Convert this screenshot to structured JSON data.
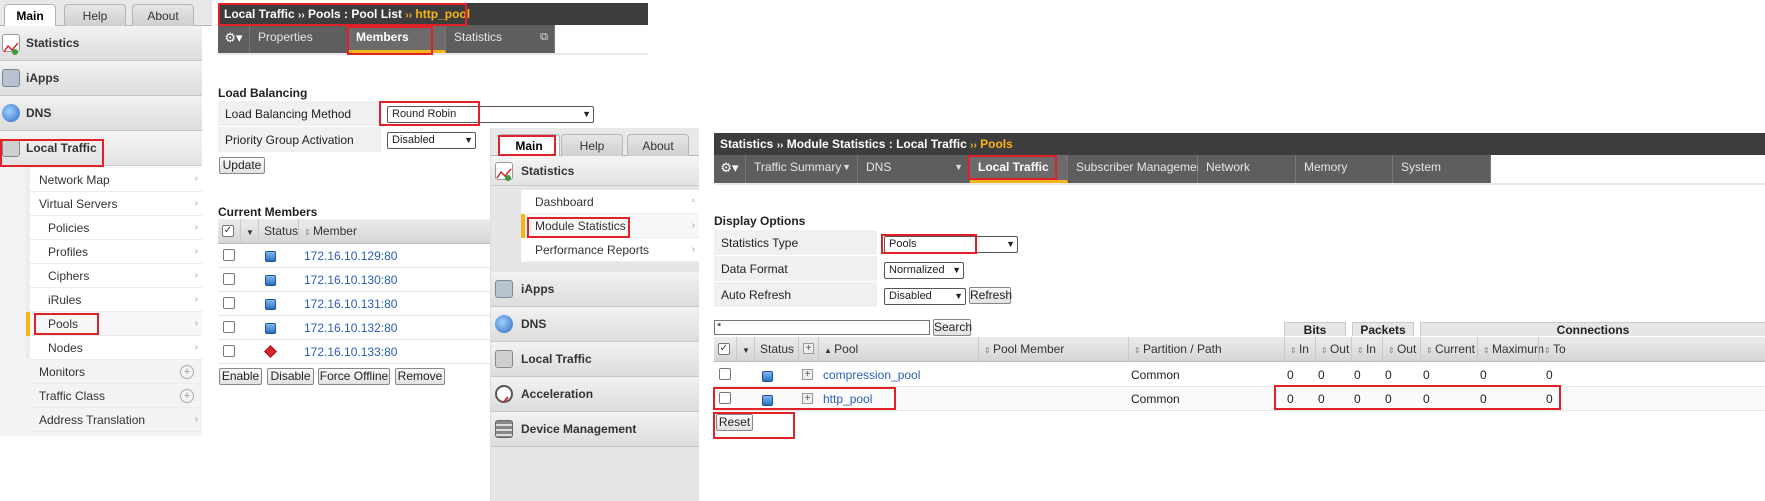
{
  "left_window": {
    "top_tabs": [
      "Main",
      "Help",
      "About"
    ],
    "title": {
      "part1": "Local Traffic",
      "sep1": "››",
      "part2": "Pools : Pool List",
      "sep2": "››",
      "part3": "http_pool"
    },
    "tabs": {
      "properties": "Properties",
      "members": "Members",
      "statistics": "Statistics"
    },
    "nav": {
      "statistics": "Statistics",
      "iapps": "iApps",
      "dns": "DNS",
      "local_traffic": "Local Traffic",
      "sub_items": [
        "Network Map",
        "Virtual Servers",
        "Policies",
        "Profiles",
        "Ciphers",
        "iRules",
        "Pools",
        "Nodes",
        "Monitors",
        "Traffic Class",
        "Address Translation"
      ]
    },
    "load_balancing": {
      "section_title": "Load Balancing",
      "method_label": "Load Balancing Method",
      "method_value": "Round Robin",
      "priority_label": "Priority Group Activation",
      "priority_value": "Disabled",
      "update_button": "Update"
    },
    "current_members": {
      "section_title": "Current Members",
      "col_status": "Status",
      "col_member": "Member",
      "rows": [
        "172.16.10.129:80",
        "172.16.10.130:80",
        "172.16.10.131:80",
        "172.16.10.132:80",
        "172.16.10.133:80"
      ],
      "buttons": [
        "Enable",
        "Disable",
        "Force Offline",
        "Remove"
      ]
    }
  },
  "right_window": {
    "top_tabs": [
      "Main",
      "Help",
      "About"
    ],
    "title": {
      "part1": "Statistics",
      "sep1": "››",
      "part2": "Module Statistics : Local Traffic",
      "sep2": "››",
      "part3": "Pools"
    },
    "tabs": [
      "Traffic Summary",
      "DNS",
      "Local Traffic",
      "Subscriber Management",
      "Network",
      "Memory",
      "System"
    ],
    "nav": {
      "statistics": "Statistics",
      "sub_items": [
        "Dashboard",
        "Module Statistics",
        "Performance Reports"
      ],
      "iapps": "iApps",
      "dns": "DNS",
      "local_traffic": "Local Traffic",
      "acceleration": "Acceleration",
      "device_management": "Device Management"
    },
    "display_options": {
      "section_title": "Display Options",
      "stats_type_label": "Statistics Type",
      "stats_type_value": "Pools",
      "data_format_label": "Data Format",
      "data_format_value": "Normalized",
      "auto_refresh_label": "Auto Refresh",
      "auto_refresh_value": "Disabled",
      "refresh_button": "Refresh"
    },
    "search": {
      "value": "*",
      "button": "Search"
    },
    "table": {
      "groups": {
        "bits": "Bits",
        "packets": "Packets",
        "connections": "Connections"
      },
      "columns": {
        "status": "Status",
        "pool": "Pool",
        "pool_member": "Pool Member",
        "partition": "Partition / Path",
        "in": "In",
        "out": "Out",
        "current": "Current",
        "maximum": "Maximum",
        "total": "To"
      },
      "rows": [
        {
          "pool": "compression_pool",
          "partition": "Common",
          "bits_in": "0",
          "bits_out": "0",
          "pkt_in": "0",
          "pkt_out": "0",
          "cur": "0",
          "max": "0",
          "tot": "0"
        },
        {
          "pool": "http_pool",
          "partition": "Common",
          "bits_in": "0",
          "bits_out": "0",
          "pkt_in": "0",
          "pkt_out": "0",
          "cur": "0",
          "max": "0",
          "tot": "0"
        }
      ],
      "reset_button": "Reset"
    }
  },
  "colors": {
    "accent": "#f7b418",
    "highlight_box": "#e2202a",
    "link": "#2760b3",
    "title_bar": "#3d3d3d"
  }
}
